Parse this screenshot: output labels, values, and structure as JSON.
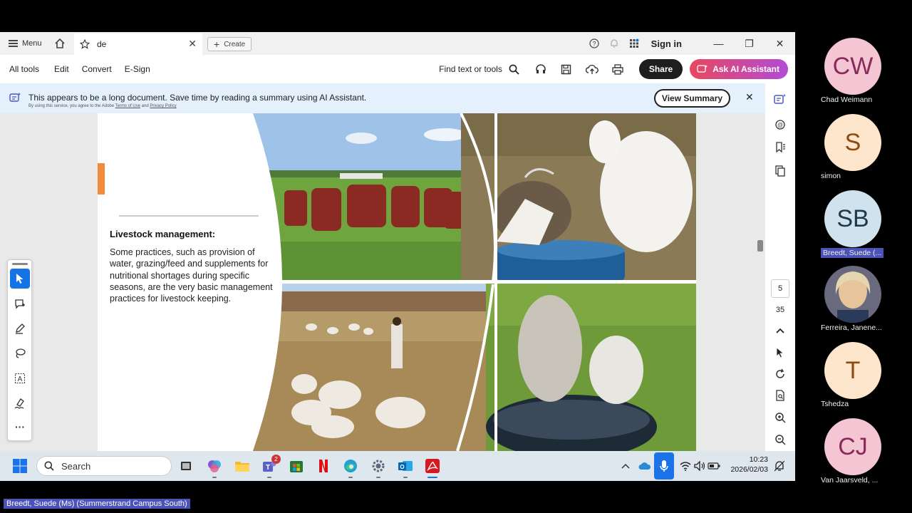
{
  "tabbar": {
    "menu_label": "Menu",
    "doc_tab_title": "de",
    "create_label": "Create",
    "signin_label": "Sign in"
  },
  "toolbar": {
    "items": [
      "All tools",
      "Edit",
      "Convert",
      "E-Sign"
    ],
    "find_label": "Find text or tools",
    "share_label": "Share",
    "ai_label": "Ask AI Assistant"
  },
  "banner": {
    "text": "This appears to be a long document. Save time by reading a summary using AI Assistant.",
    "sub_prefix": "By using this service, you agree to the Adobe",
    "terms_link": "Terms of Use",
    "sub_and": "and",
    "privacy_link": "Privacy Policy",
    "view_summary_label": "View Summary"
  },
  "slide": {
    "title": "Livestock management:",
    "body": "Some practices, such as provision of water, grazing/feed and supplements for nutritional shortages during specific seasons, are the very basic management practices for livestock keeping."
  },
  "page_nav": {
    "current_page": "5",
    "total_pages": "35"
  },
  "taskbar": {
    "search_label": "Search",
    "teams_badge": "2",
    "time": "10:23",
    "date": "2026/02/03"
  },
  "participants": [
    {
      "initials": "CW",
      "name": "Chad Weimann",
      "color": "#f4c6d4",
      "text_color": "#8a2a5a"
    },
    {
      "initials": "S",
      "name": "simon",
      "color": "#fde6cc",
      "text_color": "#8a4b12"
    },
    {
      "initials": "SB",
      "name": "Breedt, Suede (...",
      "color": "#cfe2ee",
      "text_color": "#1e3a4a"
    },
    {
      "initials": "",
      "name": "Ferreira, Janene...",
      "color": "#7a6a8a",
      "text_color": "#fff"
    },
    {
      "initials": "T",
      "name": "Tshedza",
      "color": "#fde6cc",
      "text_color": "#8a4b12"
    },
    {
      "initials": "CJ",
      "name": "Van Jaarsveld, ...",
      "color": "#f4c6d4",
      "text_color": "#8a2a5a"
    }
  ],
  "speaker_label": "Breedt, Suede (Ms) (Summerstrand Campus South)"
}
